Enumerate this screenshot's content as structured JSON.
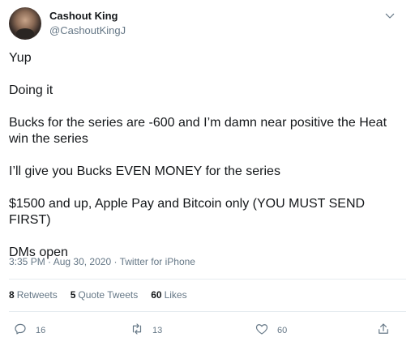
{
  "author": {
    "name": "Cashout King",
    "handle": "@CashoutKingJ"
  },
  "tweet": {
    "paragraphs": [
      "Yup",
      "Doing it",
      "Bucks for the series are -600 and I’m damn near positive the Heat win the series",
      "I’ll give you Bucks EVEN MONEY for the series",
      "$1500 and up, Apple Pay and Bitcoin only (YOU MUST SEND FIRST)",
      "DMs open"
    ],
    "time": "3:35 PM",
    "date": "Aug 30, 2020",
    "source": "Twitter for iPhone"
  },
  "stats": {
    "retweets_count": "8",
    "retweets_label": "Retweets",
    "quotes_count": "5",
    "quotes_label": "Quote Tweets",
    "likes_count": "60",
    "likes_label": "Likes"
  },
  "actions": {
    "reply_count": "16",
    "retweet_count": "13",
    "like_count": "60"
  },
  "icons": {
    "more": "chevron-down-icon",
    "reply": "reply-icon",
    "retweet": "retweet-icon",
    "like": "heart-icon",
    "share": "share-icon"
  },
  "colors": {
    "text": "#14171a",
    "secondary": "#657786",
    "divider": "#e6ecf0"
  }
}
